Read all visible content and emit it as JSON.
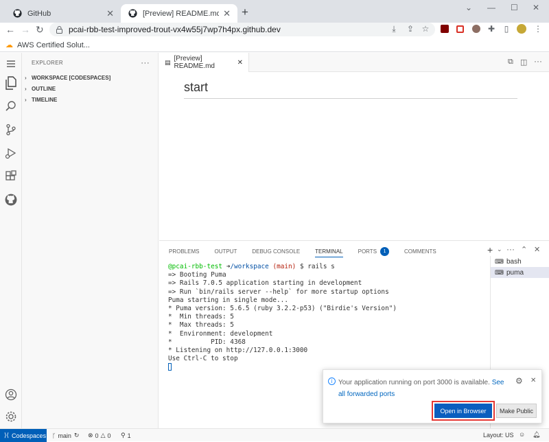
{
  "browser": {
    "tabs": [
      {
        "title": "GitHub",
        "active": false
      },
      {
        "title": "[Preview] README.md - workspa",
        "active": true
      }
    ],
    "url": "pcai-rbb-test-improved-trout-vx4w55j7wp7h4px.github.dev",
    "bookmark": "AWS Certified Solut..."
  },
  "explorer": {
    "title": "EXPLORER",
    "sections": [
      "WORKSPACE [CODESPACES]",
      "OUTLINE",
      "TIMELINE"
    ]
  },
  "editor": {
    "tab_label": "[Preview] README.md",
    "heading": "start"
  },
  "panel": {
    "tabs": [
      "PROBLEMS",
      "OUTPUT",
      "DEBUG CONSOLE",
      "TERMINAL",
      "PORTS",
      "COMMENTS"
    ],
    "ports_count": "1",
    "prompt_user": "@pcai-rbb-test",
    "prompt_arrow": "➜",
    "prompt_path": "/workspace",
    "prompt_branch": "(main)",
    "prompt_cmd": "$ rails s",
    "terminal_lines": [
      "=> Booting Puma",
      "=> Rails 7.0.5 application starting in development",
      "=> Run `bin/rails server --help` for more startup options",
      "Puma starting in single mode...",
      "* Puma version: 5.6.5 (ruby 3.2.2-p53) (\"Birdie's Version\")",
      "*  Min threads: 5",
      "*  Max threads: 5",
      "*  Environment: development",
      "*          PID: 4368",
      "* Listening on http://127.0.0.1:3000",
      "Use Ctrl-C to stop"
    ],
    "terminals": [
      "bash",
      "puma"
    ]
  },
  "notification": {
    "message": "Your application running on port 3000 is available.",
    "link": "See all forwarded ports",
    "primary_button": "Open in Browser",
    "secondary_button": "Make Public"
  },
  "statusbar": {
    "remote": "Codespaces",
    "branch": "main",
    "errors": "0",
    "warnings": "0",
    "ports": "1",
    "layout": "Layout: US"
  },
  "colors": {
    "accent": "#005fb8",
    "button": "#0a5ebf",
    "highlight": "#e53935"
  }
}
